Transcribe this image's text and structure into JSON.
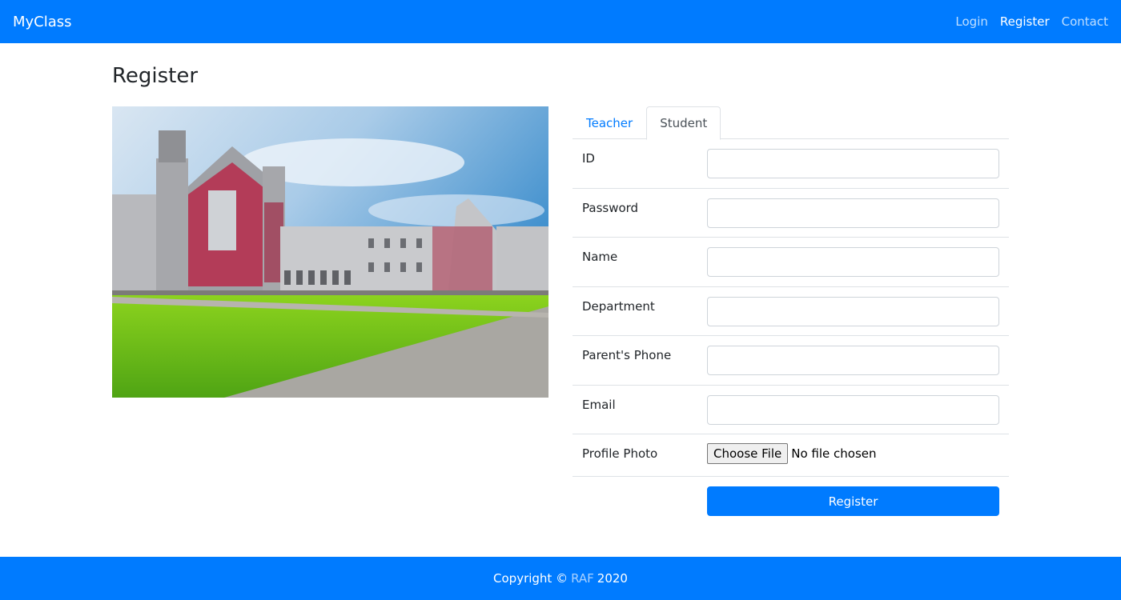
{
  "navbar": {
    "brand": "MyClass",
    "links": [
      {
        "label": "Login"
      },
      {
        "label": "Register"
      },
      {
        "label": "Contact"
      }
    ]
  },
  "page": {
    "title": "Register"
  },
  "tabs": [
    {
      "label": "Teacher"
    },
    {
      "label": "Student"
    }
  ],
  "form": {
    "fields": [
      {
        "label": "ID",
        "value": ""
      },
      {
        "label": "Password",
        "value": ""
      },
      {
        "label": "Name",
        "value": ""
      },
      {
        "label": "Department",
        "value": ""
      },
      {
        "label": "Parent's Phone",
        "value": ""
      },
      {
        "label": "Email",
        "value": ""
      }
    ],
    "photo": {
      "label": "Profile Photo",
      "button": "Choose File",
      "status": "No file chosen"
    },
    "submit": "Register"
  },
  "footer": {
    "prefix": "Copyright ©",
    "link": "RAF",
    "year": "2020"
  },
  "colors": {
    "primary": "#007bff",
    "border": "#dee2e6"
  }
}
